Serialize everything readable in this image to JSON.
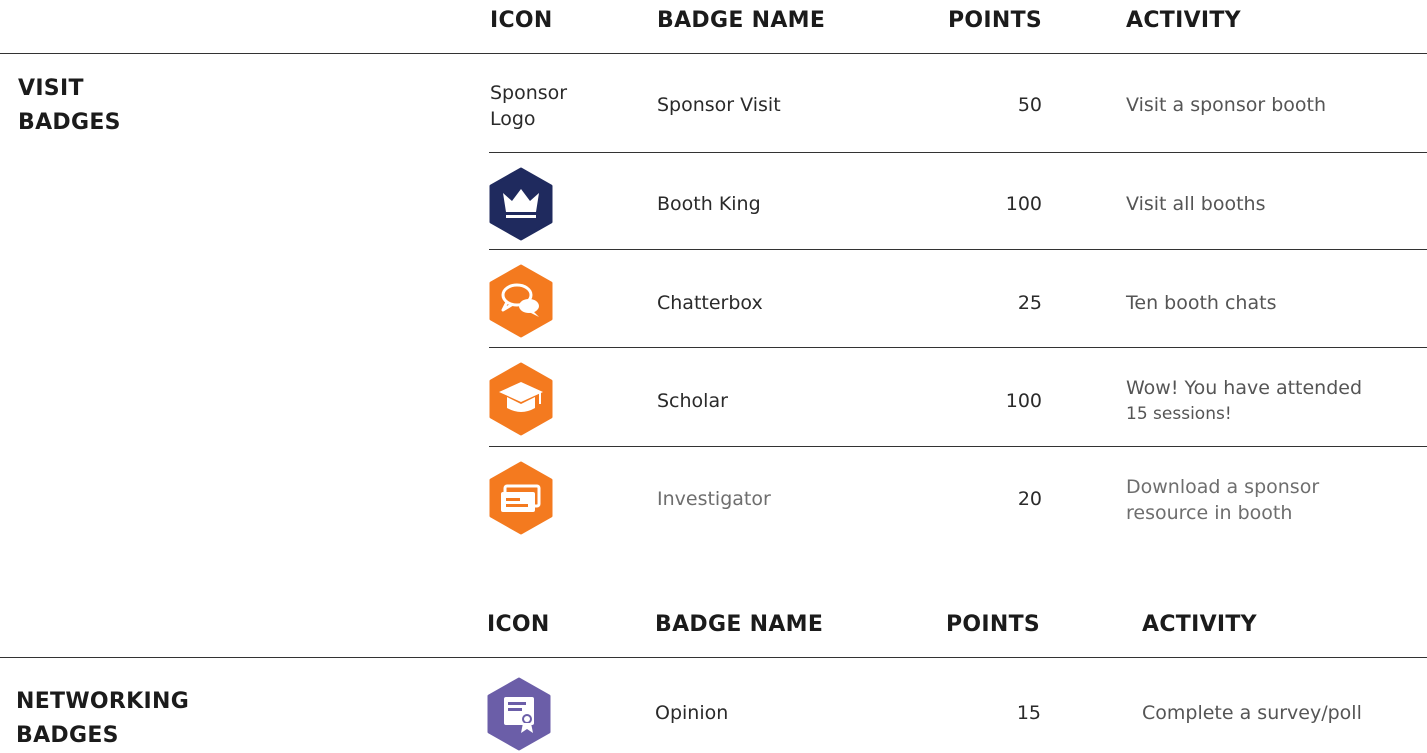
{
  "visit_table": {
    "headers": {
      "icon": "ICON",
      "name": "BADGE NAME",
      "points": "POINTS",
      "activity": "ACTIVITY"
    },
    "section_title_line1": "VISIT",
    "section_title_line2": "BADGES",
    "rows": [
      {
        "icon_text_line1": "Sponsor",
        "icon_text_line2": "Logo",
        "icon": "sponsor-logo-placeholder",
        "name": "Sponsor Visit",
        "points": "50",
        "activity_line1": "Visit a sponsor booth",
        "activity_line2": ""
      },
      {
        "icon": "crown-icon",
        "icon_color": "#1f2a5e",
        "name": "Booth King",
        "points": "100",
        "activity_line1": "Visit all booths",
        "activity_line2": ""
      },
      {
        "icon": "chat-bubbles-icon",
        "icon_color": "#f47a1f",
        "name": "Chatterbox",
        "points": "25",
        "activity_line1": "Ten booth chats",
        "activity_line2": ""
      },
      {
        "icon": "graduation-cap-icon",
        "icon_color": "#f47a1f",
        "name": "Scholar",
        "points": "100",
        "activity_line1": "Wow! You have attended",
        "activity_line2": "15 sessions!"
      },
      {
        "icon": "tickets-icon",
        "icon_color": "#f47a1f",
        "name": "Investigator",
        "points": "20",
        "activity_line1": "Download a sponsor",
        "activity_line2": "resource in booth"
      }
    ]
  },
  "networking_table": {
    "headers": {
      "icon": "ICON",
      "name": "BADGE NAME",
      "points": "POINTS",
      "activity": "ACTIVITY"
    },
    "section_title_line1": "NETWORKING",
    "section_title_line2": "BADGES",
    "rows": [
      {
        "icon": "certificate-icon",
        "icon_color": "#6b5ea8",
        "name": "Opinion",
        "points": "15",
        "activity_line1": "Complete a survey/poll",
        "activity_line2": ""
      }
    ]
  }
}
